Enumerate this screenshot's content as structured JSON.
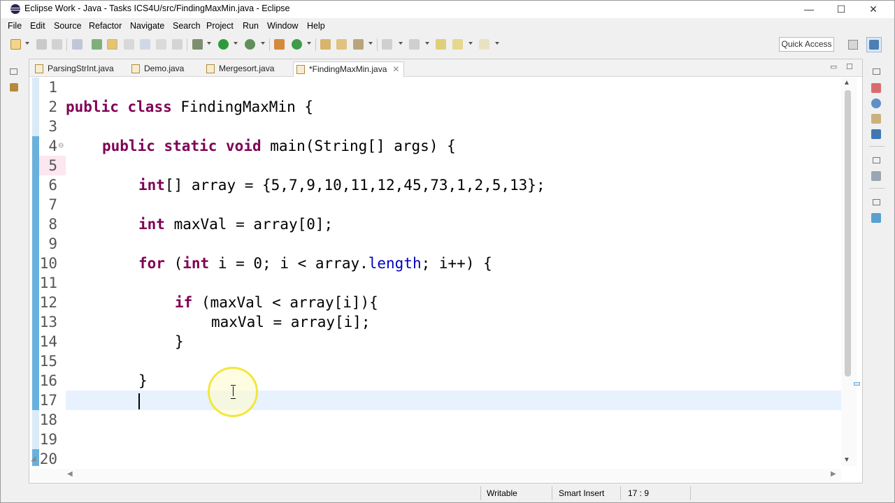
{
  "window": {
    "title": "Eclipse Work - Java - Tasks ICS4U/src/FindingMaxMin.java - Eclipse",
    "controls": {
      "minimize": "—",
      "maximize": "☐",
      "close": "✕"
    }
  },
  "menu": [
    "File",
    "Edit",
    "Source",
    "Refactor",
    "Navigate",
    "Search",
    "Project",
    "Run",
    "Window",
    "Help"
  ],
  "toolbar": {
    "quick_access": "Quick Access"
  },
  "tabs": [
    {
      "label": "ParsingStrInt.java",
      "active": false
    },
    {
      "label": "Demo.java",
      "active": false
    },
    {
      "label": "Mergesort.java",
      "active": false
    },
    {
      "label": "*FindingMaxMin.java",
      "active": true,
      "close": "✕"
    }
  ],
  "editor": {
    "line_numbers": [
      "1",
      "2",
      "3",
      "4",
      "5",
      "6",
      "7",
      "8",
      "9",
      "10",
      "11",
      "12",
      "13",
      "14",
      "15",
      "16",
      "17",
      "18",
      "19",
      "20"
    ],
    "code": {
      "l2": {
        "kw1": "public",
        "kw2": "class",
        "rest": " FindingMaxMin {"
      },
      "l4": {
        "kw1": "public",
        "kw2": "static",
        "kw3": "void",
        "rest": " main(String[] args) {"
      },
      "l6": {
        "kw1": "int",
        "rest": "[] array = {5,7,9,10,11,12,45,73,1,2,5,13};"
      },
      "l8": {
        "kw1": "int",
        "rest": " maxVal = array[0];"
      },
      "l10": {
        "kw1": "for",
        "p1": " (",
        "kw2": "int",
        "p2": " i = 0; i < array.",
        "field": "length",
        "p3": "; i++) {"
      },
      "l12": {
        "kw1": "if",
        "rest": " (maxVal < array[i]){"
      },
      "l13": {
        "rest": "maxVal = array[i];"
      },
      "l14": {
        "rest": "}"
      },
      "l16": {
        "rest": "}"
      }
    }
  },
  "status": {
    "writable": "Writable",
    "insert_mode": "Smart Insert",
    "position": "17 : 9"
  },
  "colors": {
    "keyword": "#7f0055",
    "field": "#0000c0",
    "current_line": "#e8f2fe",
    "ruler": "#d9ebf6"
  }
}
